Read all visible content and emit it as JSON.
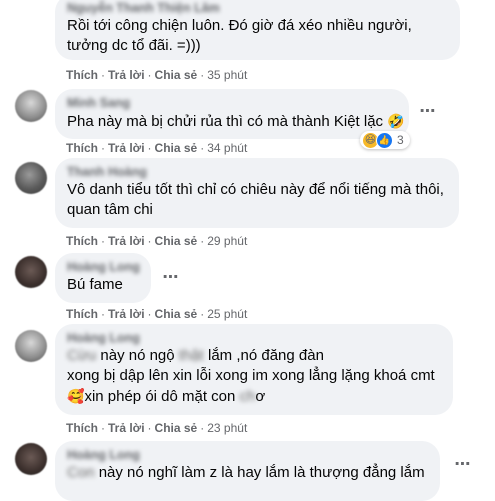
{
  "actions": {
    "like": "Thích",
    "reply": "Trả lời",
    "share": "Chia sẻ",
    "sep": "·"
  },
  "more_icon": "⋯",
  "comments": [
    {
      "author": "Nguyễn Thanh Thiện Lâm",
      "lines": [
        "Rồi tới công chiện luôn. Đó giờ đá xéo nhiều người,",
        "tưởng dc tổ đãi. =)))"
      ],
      "time": "35 phút"
    },
    {
      "author": "Minh Sang",
      "lines": [
        "Pha này mà bị chửi rủa thì có mà thành Kiệt lặc"
      ],
      "emoji": "🤣",
      "time": "34 phút",
      "reactions": {
        "icons": [
          "haha-icon",
          "like-icon"
        ],
        "count": "3"
      }
    },
    {
      "author": "Thanh Hoàng",
      "lines": [
        "Vô danh tiểu tốt thì chỉ có chiêu này để nổi tiếng mà thôi,",
        "quan tâm chi"
      ],
      "time": "29 phút"
    },
    {
      "author": "Hoàng Long",
      "lines": [
        "Bú fame"
      ],
      "time": "25 phút"
    },
    {
      "author": "Hoàng Long",
      "sub": "Cừu Bé Hoàng",
      "l1a": "Cừu",
      "l1b": " này nó ngộ ",
      "l1c": "thật",
      "l1d": " lắm ,nó đăng đàn ",
      "line2": "xong bị dập lên xin lỗi xong im xong lẳng lặng khoá cmt",
      "l3emoji": "🥰",
      "l3a": "xin phép ói dô mặt con ",
      "l3b": "ch",
      "l3c": "ơ",
      "time": "23 phút"
    },
    {
      "author": "Hoàng Long",
      "l1a": "Con",
      "l1b": " này nó nghĩ làm z là hay lắm là thượng đẳng lắm"
    }
  ]
}
